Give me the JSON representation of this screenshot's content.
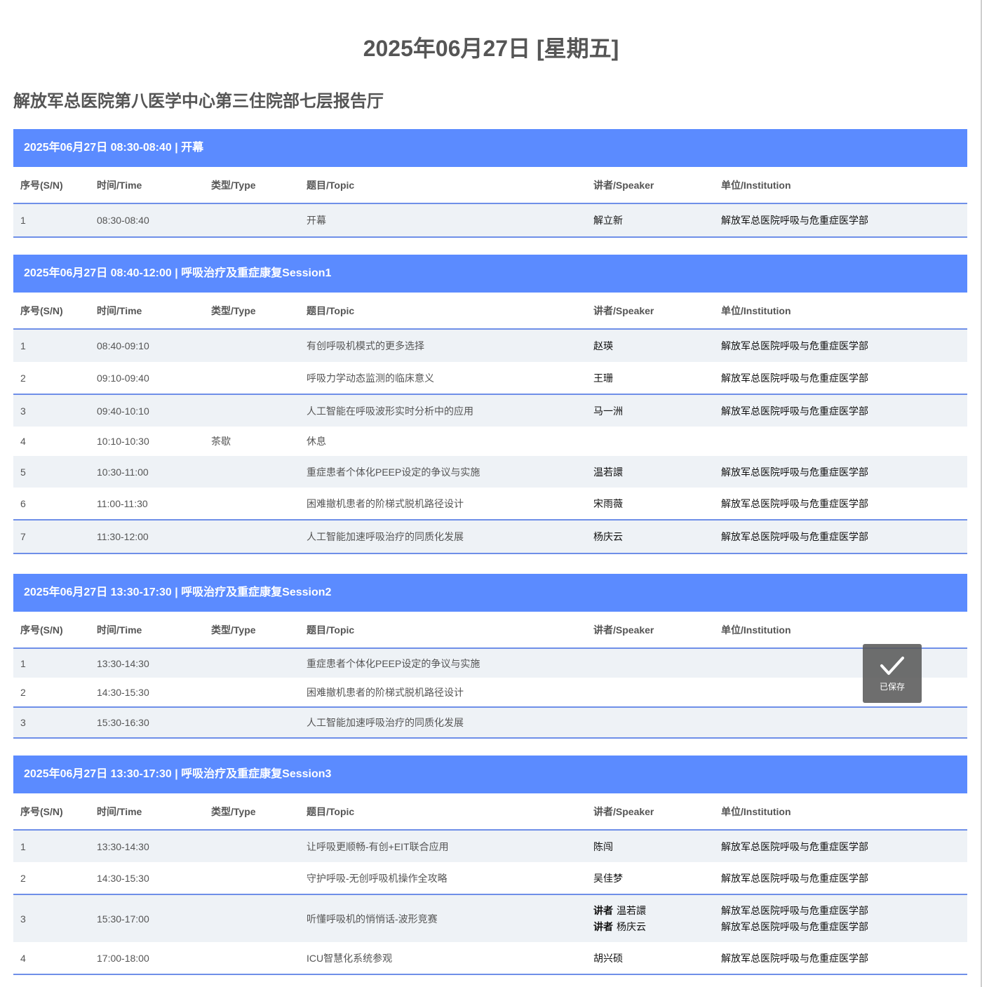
{
  "page": {
    "date_title": "2025年06月27日 [星期五]",
    "venue": "解放军总医院第八医学中心第三住院部七层报告厅"
  },
  "columns": {
    "sn": "序号(S/N)",
    "time": "时间/Time",
    "type": "类型/Type",
    "topic": "题目/Topic",
    "speaker": "讲者/Speaker",
    "institution": "单位/Institution"
  },
  "sessions": [
    {
      "header": "2025年06月27日 08:30-08:40 | 开幕",
      "rows": [
        {
          "sn": "1",
          "time": "08:30-08:40",
          "type": "",
          "topic": "开幕",
          "speaker": "解立新",
          "institution": "解放军总医院呼吸与危重症医学部"
        }
      ]
    },
    {
      "header": "2025年06月27日 08:40-12:00 | 呼吸治疗及重症康复Session1",
      "rows": [
        {
          "sn": "1",
          "time": "08:40-09:10",
          "type": "",
          "topic": "有创呼吸机模式的更多选择",
          "speaker": "赵瑛",
          "institution": "解放军总医院呼吸与危重症医学部"
        },
        {
          "sn": "2",
          "time": "09:10-09:40",
          "type": "",
          "topic": "呼吸力学动态监测的临床意义",
          "speaker": "王珊",
          "institution": "解放军总医院呼吸与危重症医学部"
        },
        {
          "sn": "3",
          "time": "09:40-10:10",
          "type": "",
          "topic": "人工智能在呼吸波形实时分析中的应用",
          "speaker": "马一洲",
          "institution": "解放军总医院呼吸与危重症医学部"
        },
        {
          "sn": "4",
          "time": "10:10-10:30",
          "type": "茶歇",
          "topic": "休息",
          "speaker": "",
          "institution": ""
        },
        {
          "sn": "5",
          "time": "10:30-11:00",
          "type": "",
          "topic": "重症患者个体化PEEP设定的争议与实施",
          "speaker": "温若譞",
          "institution": "解放军总医院呼吸与危重症医学部"
        },
        {
          "sn": "6",
          "time": "11:00-11:30",
          "type": "",
          "topic": "困难撤机患者的阶梯式脱机路径设计",
          "speaker": "宋雨薇",
          "institution": "解放军总医院呼吸与危重症医学部"
        },
        {
          "sn": "7",
          "time": "11:30-12:00",
          "type": "",
          "topic": "人工智能加速呼吸治疗的同质化发展",
          "speaker": "杨庆云",
          "institution": "解放军总医院呼吸与危重症医学部"
        }
      ]
    },
    {
      "header": "2025年06月27日 13:30-17:30 | 呼吸治疗及重症康复Session2",
      "rows": [
        {
          "sn": "1",
          "time": "13:30-14:30",
          "type": "",
          "topic": "重症患者个体化PEEP设定的争议与实施",
          "speaker": "",
          "institution": ""
        },
        {
          "sn": "2",
          "time": "14:30-15:30",
          "type": "",
          "topic": "困难撤机患者的阶梯式脱机路径设计",
          "speaker": "",
          "institution": ""
        },
        {
          "sn": "3",
          "time": "15:30-16:30",
          "type": "",
          "topic": "人工智能加速呼吸治疗的同质化发展",
          "speaker": "",
          "institution": ""
        }
      ]
    },
    {
      "header": "2025年06月27日 13:30-17:30 | 呼吸治疗及重症康复Session3",
      "rows": [
        {
          "sn": "1",
          "time": "13:30-14:30",
          "type": "",
          "topic": "让呼吸更顺畅-有创+EIT联合应用",
          "speaker": "陈闯",
          "institution": "解放军总医院呼吸与危重症医学部"
        },
        {
          "sn": "2",
          "time": "14:30-15:30",
          "type": "",
          "topic": "守护呼吸-无创呼吸机操作全攻略",
          "speaker": "吴佳梦",
          "institution": "解放军总医院呼吸与危重症医学部"
        },
        {
          "sn": "3",
          "time": "15:30-17:00",
          "type": "",
          "topic": "听懂呼吸机的悄悄话-波形竞赛",
          "speakers": [
            {
              "role": "讲者",
              "name": "温若譞"
            },
            {
              "role": "讲者",
              "name": "杨庆云"
            }
          ],
          "institutions": [
            "解放军总医院呼吸与危重症医学部",
            "解放军总医院呼吸与危重症医学部"
          ]
        },
        {
          "sn": "4",
          "time": "17:00-18:00",
          "type": "",
          "topic": "ICU智慧化系统参观",
          "speaker": "胡兴硕",
          "institution": "解放军总医院呼吸与危重症医学部"
        }
      ]
    }
  ],
  "toast": {
    "icon": "check-icon",
    "label": "已保存"
  }
}
